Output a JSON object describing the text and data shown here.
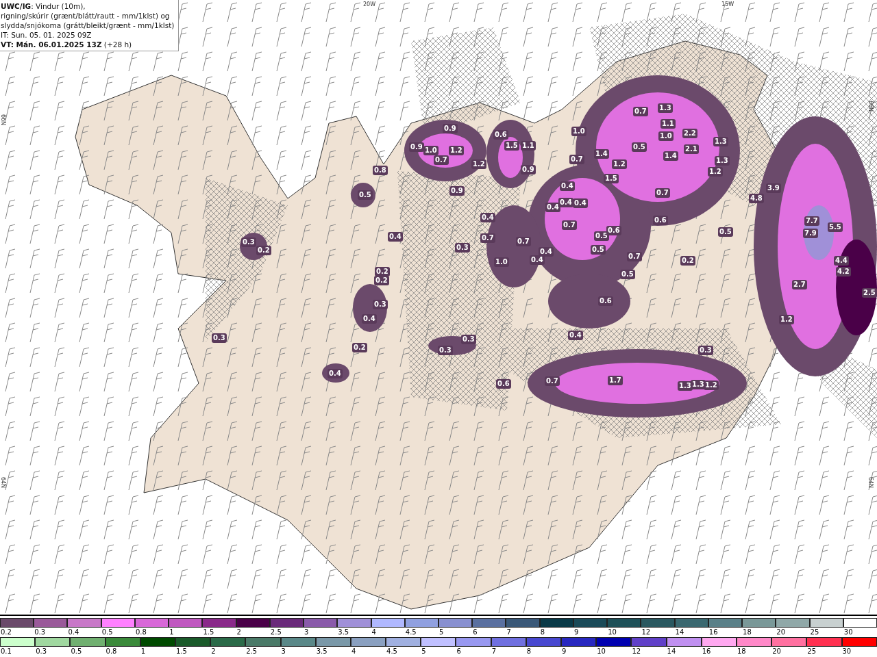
{
  "header": {
    "lines": [
      "**UWC/IG**: Vindur (10m),",
      "rigning/skúrir (grænt/blátt/rautt - mm/1klst) og",
      "slydda/snjókoma (grátt/bleikt/grænt - mm/1klst)",
      "IT: Sun. 05. 01. 2025 09Z",
      "**VT: Mán. 06.01.2025 13Z** (+28 h)"
    ]
  },
  "axis_labels": [
    {
      "text": "20W",
      "kind": "top"
    },
    {
      "text": "15W",
      "kind": "top"
    },
    {
      "text": "66N",
      "kind": "left"
    },
    {
      "text": "64N",
      "kind": "left"
    },
    {
      "text": "66N",
      "kind": "right"
    },
    {
      "text": "64N",
      "kind": "right"
    }
  ],
  "map": {
    "value_labels": [
      "0.9",
      "1.0",
      "0.9",
      "0.7",
      "1.2",
      "1.2",
      "0.9",
      "0.6",
      "1.5",
      "1.1",
      "0.9",
      "1.0",
      "0.7",
      "1.3",
      "1.1",
      "1.0",
      "2.2",
      "2.1",
      "1.3",
      "0.5",
      "1.4",
      "1.2",
      "1.3",
      "1.2",
      "1.4",
      "0.7",
      "1.5",
      "3.9",
      "4.8",
      "7.7",
      "7.9",
      "5.5",
      "4.4",
      "4.2",
      "2.7",
      "2.5",
      "1.2",
      "0.5",
      "0.4",
      "0.4",
      "0.3",
      "0.2",
      "0.4",
      "0.4",
      "0.4",
      "0.4",
      "0.7",
      "0.6",
      "0.7",
      "0.5",
      "0.6",
      "0.5",
      "0.7",
      "0.7",
      "0.4",
      "1.0",
      "0.4",
      "0.5",
      "0.7",
      "0.5",
      "0.2",
      "0.2",
      "0.2",
      "0.3",
      "0.4",
      "0.6",
      "0.4",
      "0.3",
      "0.2",
      "0.3",
      "0.3",
      "0.4",
      "0.7",
      "1.7",
      "1.3",
      "1.3",
      "1.2",
      "0.3",
      "0.6",
      "0.3",
      "0.8"
    ]
  },
  "legend": {
    "rows": [
      {
        "items": [
          {
            "label": "0.2",
            "color": "#6b4a6b"
          },
          {
            "label": "0.3",
            "color": "#9a5a9a"
          },
          {
            "label": "0.4",
            "color": "#c878c8"
          },
          {
            "label": "0.5",
            "color": "#ff80ff"
          },
          {
            "label": "0.8",
            "color": "#d868d8"
          },
          {
            "label": "1",
            "color": "#c058c0"
          },
          {
            "label": "1.5",
            "color": "#8a2a8a"
          },
          {
            "label": "2",
            "color": "#4a0048"
          },
          {
            "label": "2.5",
            "color": "#6a2a7a"
          },
          {
            "label": "3",
            "color": "#8a5aaa"
          },
          {
            "label": "3.5",
            "color": "#a090d8"
          },
          {
            "label": "4",
            "color": "#b0b8ff"
          },
          {
            "label": "4.5",
            "color": "#90a0e0"
          },
          {
            "label": "5",
            "color": "#8890d0"
          },
          {
            "label": "6",
            "color": "#5a70a0"
          },
          {
            "label": "7",
            "color": "#3a5878"
          },
          {
            "label": "8",
            "color": "#0a3a48"
          },
          {
            "label": "9",
            "color": "#1a4a58"
          },
          {
            "label": "10",
            "color": "#1e5058"
          },
          {
            "label": "12",
            "color": "#2a5860"
          },
          {
            "label": "14",
            "color": "#3a6870"
          },
          {
            "label": "16",
            "color": "#5a8088"
          },
          {
            "label": "18",
            "color": "#7a9898"
          },
          {
            "label": "20",
            "color": "#90a8a8"
          },
          {
            "label": "25",
            "color": "#c8d0d0"
          },
          {
            "label": "30",
            "color": "#ffffff"
          }
        ]
      },
      {
        "items": [
          {
            "label": "0.1",
            "color": "#ccffcc"
          },
          {
            "label": "0.3",
            "color": "#a0d8a0"
          },
          {
            "label": "0.5",
            "color": "#70b070"
          },
          {
            "label": "0.8",
            "color": "#3a8a3a"
          },
          {
            "label": "1",
            "color": "#004a00"
          },
          {
            "label": "1.5",
            "color": "#1a5a2a"
          },
          {
            "label": "2",
            "color": "#2a6a48"
          },
          {
            "label": "2.5",
            "color": "#4a7a68"
          },
          {
            "label": "3",
            "color": "#5a8888"
          },
          {
            "label": "3.5",
            "color": "#7a98a8"
          },
          {
            "label": "4",
            "color": "#8aa0c0"
          },
          {
            "label": "4.5",
            "color": "#a0b0e0"
          },
          {
            "label": "5",
            "color": "#c0c0ff"
          },
          {
            "label": "6",
            "color": "#9898f0"
          },
          {
            "label": "7",
            "color": "#7070e0"
          },
          {
            "label": "8",
            "color": "#4848d0"
          },
          {
            "label": "9",
            "color": "#2828c0"
          },
          {
            "label": "10",
            "color": "#0000b0"
          },
          {
            "label": "12",
            "color": "#6040c8"
          },
          {
            "label": "14",
            "color": "#c090f0"
          },
          {
            "label": "16",
            "color": "#ffa8f0"
          },
          {
            "label": "18",
            "color": "#ff88c8"
          },
          {
            "label": "20",
            "color": "#ff70a0"
          },
          {
            "label": "25",
            "color": "#ff3050"
          },
          {
            "label": "30",
            "color": "#ff0000"
          }
        ]
      }
    ]
  }
}
